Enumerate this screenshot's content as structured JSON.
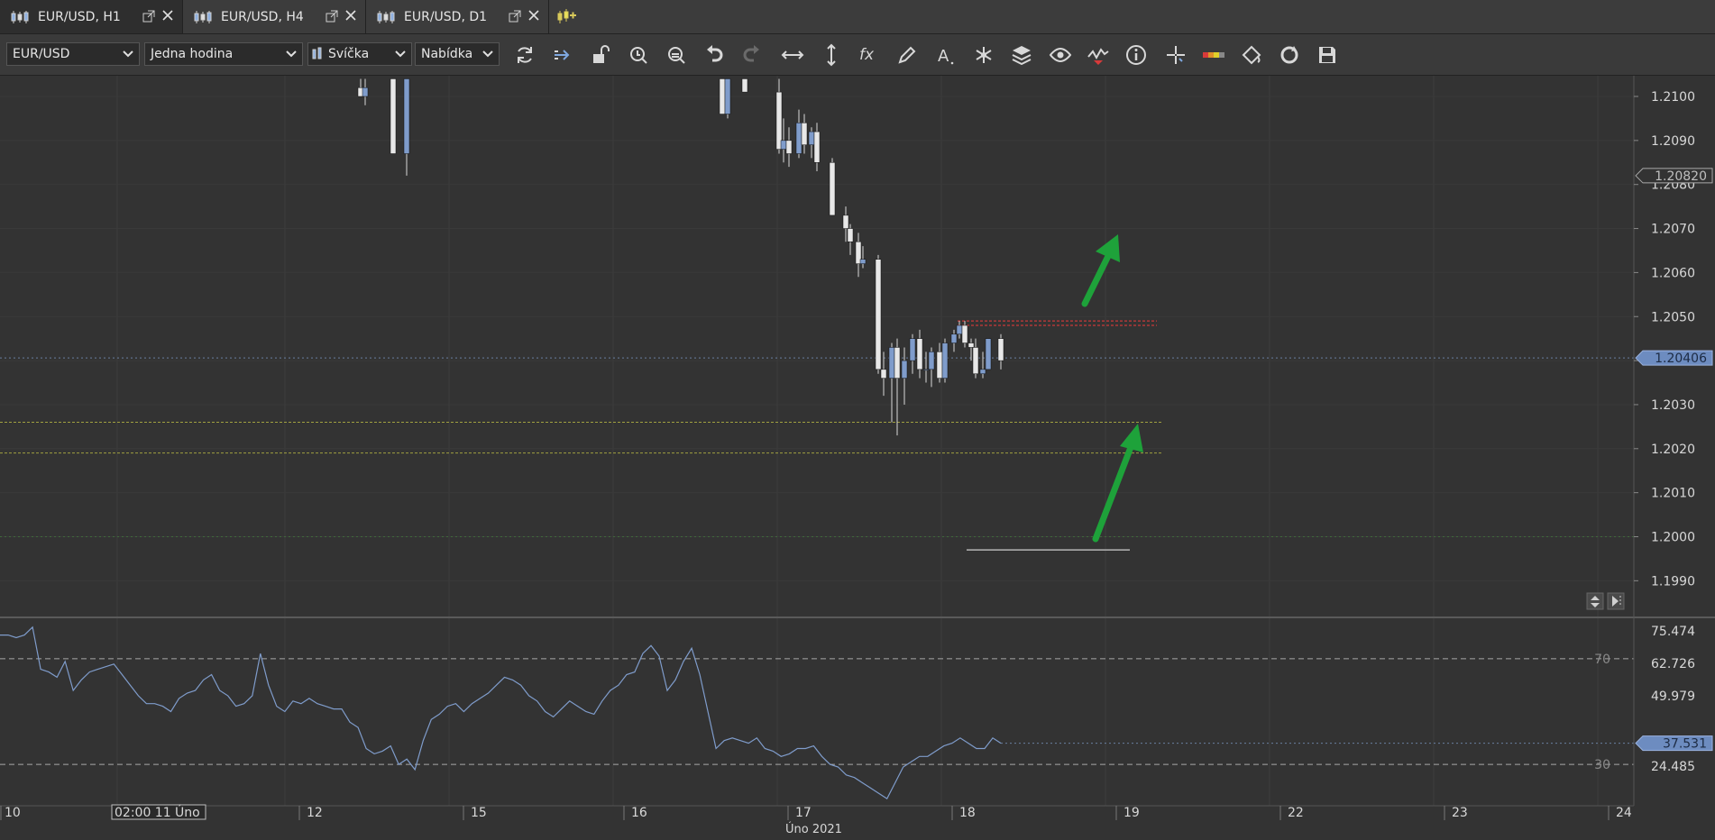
{
  "tabs": [
    {
      "label": "EUR/USD, H1",
      "active": true
    },
    {
      "label": "EUR/USD, H4",
      "active": false
    },
    {
      "label": "EUR/USD, D1",
      "active": false
    }
  ],
  "toolbar": {
    "instrument": "EUR/USD",
    "period": "Jedna hodina",
    "chart_type": "Svíčka",
    "price_type": "Nabídka",
    "icons": [
      "refresh-icon",
      "shift-icon",
      "lock-icon",
      "zoom-in-icon",
      "zoom-out-icon",
      "undo-icon",
      "redo-icon",
      "horizontal-scale-icon",
      "vertical-scale-icon",
      "indicators-icon",
      "draw-icon",
      "text-icon",
      "tools-icon",
      "layers-icon",
      "eye-icon",
      "signals-icon",
      "info-icon",
      "crosshair-icon",
      "color-bar-icon",
      "theme-icon",
      "sync-icon",
      "save-icon"
    ]
  },
  "price_axis": {
    "labels": [
      "1.2100",
      "1.2090",
      "1.2080",
      "1.2070",
      "1.2060",
      "1.2050",
      "1.2040",
      "1.2030",
      "1.2020",
      "1.2010",
      "1.2000",
      "1.1990"
    ],
    "marker_high": "1.20820",
    "marker_current": "1.20406"
  },
  "rsi_panel": {
    "axis_labels": [
      "75.474",
      "62.726",
      "49.979",
      "24.485"
    ],
    "marker_current": "37.531",
    "level_upper": "70",
    "level_lower": "30"
  },
  "time_axis": {
    "labels": [
      "10",
      "02:00 11 Úno",
      "12",
      "15",
      "16",
      "17",
      "18",
      "19",
      "22",
      "23",
      "24"
    ],
    "month_label": "Úno 2021"
  },
  "colors": {
    "bull": "#7f9ccb",
    "bear": "#e8e8e8",
    "rsi_line": "#7f9ccb",
    "arrow": "#1ea23a",
    "resistance": "#c83a3a",
    "support": "#a0a040"
  },
  "chart_data": {
    "type": "candlestick",
    "instrument": "EUR/USD",
    "timeframe": "H1",
    "ylim": [
      1.1985,
      1.2105
    ],
    "visible_candles": [
      {
        "o": 1.2102,
        "h": 1.2104,
        "l": 1.21,
        "c": 1.21
      },
      {
        "o": 1.21,
        "h": 1.2104,
        "l": 1.2098,
        "c": 1.2102
      },
      {
        "o": 1.2104,
        "h": 1.2104,
        "l": 1.2087,
        "c": 1.2087
      },
      {
        "o": 1.2087,
        "h": 1.2104,
        "l": 1.2082,
        "c": 1.2104
      },
      {
        "o": 1.2104,
        "h": 1.2104,
        "l": 1.2096,
        "c": 1.2096
      },
      {
        "o": 1.2096,
        "h": 1.2104,
        "l": 1.2095,
        "c": 1.2104
      },
      {
        "o": 1.2104,
        "h": 1.2104,
        "l": 1.2101,
        "c": 1.2101
      },
      {
        "o": 1.2101,
        "h": 1.2104,
        "l": 1.2087,
        "c": 1.2088
      },
      {
        "o": 1.2088,
        "h": 1.2095,
        "l": 1.2085,
        "c": 1.209
      },
      {
        "o": 1.209,
        "h": 1.2093,
        "l": 1.2084,
        "c": 1.2087
      },
      {
        "o": 1.2087,
        "h": 1.2097,
        "l": 1.2086,
        "c": 1.2094
      },
      {
        "o": 1.2094,
        "h": 1.2096,
        "l": 1.2087,
        "c": 1.2089
      },
      {
        "o": 1.2089,
        "h": 1.2093,
        "l": 1.2086,
        "c": 1.2092
      },
      {
        "o": 1.2092,
        "h": 1.2094,
        "l": 1.2083,
        "c": 1.2085
      },
      {
        "o": 1.2085,
        "h": 1.2086,
        "l": 1.2073,
        "c": 1.2073
      },
      {
        "o": 1.2073,
        "h": 1.2075,
        "l": 1.2067,
        "c": 1.207
      },
      {
        "o": 1.207,
        "h": 1.2071,
        "l": 1.2064,
        "c": 1.2067
      },
      {
        "o": 1.2067,
        "h": 1.2069,
        "l": 1.2059,
        "c": 1.2062
      },
      {
        "o": 1.2062,
        "h": 1.2066,
        "l": 1.2061,
        "c": 1.2063
      },
      {
        "o": 1.2063,
        "h": 1.2064,
        "l": 1.2037,
        "c": 1.2038
      },
      {
        "o": 1.2038,
        "h": 1.2042,
        "l": 1.2032,
        "c": 1.2036
      },
      {
        "o": 1.2036,
        "h": 1.2044,
        "l": 1.2026,
        "c": 1.2043
      },
      {
        "o": 1.2043,
        "h": 1.2045,
        "l": 1.2023,
        "c": 1.2036
      },
      {
        "o": 1.2036,
        "h": 1.2043,
        "l": 1.203,
        "c": 1.204
      },
      {
        "o": 1.204,
        "h": 1.2046,
        "l": 1.2037,
        "c": 1.2045
      },
      {
        "o": 1.2045,
        "h": 1.2047,
        "l": 1.2036,
        "c": 1.2038
      },
      {
        "o": 1.2038,
        "h": 1.2042,
        "l": 1.2035,
        "c": 1.2038
      },
      {
        "o": 1.2038,
        "h": 1.2043,
        "l": 1.2034,
        "c": 1.2042
      },
      {
        "o": 1.2042,
        "h": 1.2044,
        "l": 1.2035,
        "c": 1.2036
      },
      {
        "o": 1.2036,
        "h": 1.2045,
        "l": 1.2035,
        "c": 1.2044
      },
      {
        "o": 1.2044,
        "h": 1.2047,
        "l": 1.2042,
        "c": 1.2046
      },
      {
        "o": 1.2046,
        "h": 1.2049,
        "l": 1.2045,
        "c": 1.2048
      },
      {
        "o": 1.2048,
        "h": 1.2049,
        "l": 1.2043,
        "c": 1.2044
      },
      {
        "o": 1.2044,
        "h": 1.2045,
        "l": 1.204,
        "c": 1.2043
      },
      {
        "o": 1.2043,
        "h": 1.2045,
        "l": 1.2036,
        "c": 1.2037
      },
      {
        "o": 1.2037,
        "h": 1.2042,
        "l": 1.2036,
        "c": 1.2038
      },
      {
        "o": 1.2038,
        "h": 1.2045,
        "l": 1.2038,
        "c": 1.2045
      },
      {
        "o": 1.2045,
        "h": 1.2046,
        "l": 1.2038,
        "c": 1.204
      }
    ],
    "levels": [
      {
        "price": 1.2049,
        "kind": "resistance"
      },
      {
        "price": 1.2048,
        "kind": "resistance"
      },
      {
        "price": 1.20406,
        "kind": "current"
      },
      {
        "price": 1.2026,
        "kind": "support"
      },
      {
        "price": 1.2019,
        "kind": "support"
      },
      {
        "price": 1.2,
        "kind": "grid-green"
      },
      {
        "price": 1.1997,
        "kind": "user-line"
      }
    ],
    "rsi": {
      "ylim": [
        15,
        85
      ],
      "levels": [
        70,
        30
      ],
      "values": [
        79,
        79,
        78,
        79,
        82,
        66,
        65,
        63,
        69,
        58,
        62,
        65,
        66,
        67,
        68,
        64,
        60,
        56,
        53,
        53,
        52,
        50,
        55,
        57,
        58,
        62,
        64,
        58,
        56,
        52,
        53,
        56,
        72,
        60,
        52,
        50,
        54,
        53,
        55,
        53,
        52,
        51,
        51,
        46,
        44,
        36,
        34,
        35,
        37,
        30,
        32,
        28,
        39,
        47,
        49,
        52,
        53,
        50,
        53,
        55,
        57,
        60,
        63,
        62,
        60,
        56,
        54,
        50,
        48,
        51,
        54,
        52,
        50,
        49,
        54,
        58,
        60,
        64,
        65,
        72,
        75,
        71,
        58,
        62,
        69,
        74,
        64,
        50,
        36,
        39,
        40,
        39,
        38,
        40,
        36,
        35,
        33,
        34,
        36,
        36,
        37,
        33,
        30,
        29,
        26,
        25,
        23,
        21,
        19,
        17,
        23,
        29,
        31,
        33,
        33,
        35,
        37,
        38,
        40,
        38,
        36,
        36,
        40,
        38
      ]
    }
  }
}
